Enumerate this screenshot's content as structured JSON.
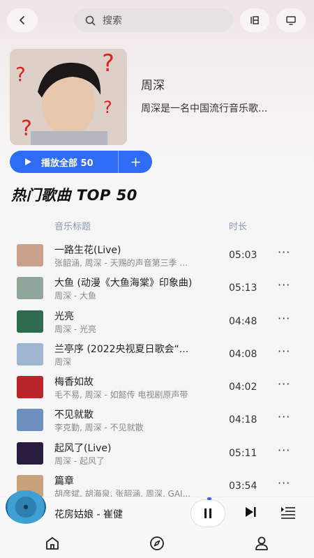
{
  "search": {
    "placeholder": "搜索"
  },
  "artist": {
    "name": "周深",
    "description": "周深是一名中国流行音乐歌..."
  },
  "play_all": {
    "label": "播放全部 50"
  },
  "section": {
    "title": "热门歌曲 TOP 50"
  },
  "columns": {
    "title": "音乐标题",
    "duration": "时长"
  },
  "songs": [
    {
      "title": "一路生花(Live)",
      "sub": "张韶涵, 周深 - 天赐的声音第三季 ...",
      "duration": "05:03",
      "cover": "#c9a08a"
    },
    {
      "title": "大鱼 (动漫《大鱼海棠》印象曲)",
      "sub": "周深 - 大鱼",
      "duration": "05:13",
      "cover": "#8fa79b"
    },
    {
      "title": "光亮",
      "sub": "周深 - 光亮",
      "duration": "04:48",
      "cover": "#2f6b4f"
    },
    {
      "title": "兰亭序 (2022央视夏日歌会“...",
      "sub": "周深",
      "duration": "04:08",
      "cover": "#9fb6d2"
    },
    {
      "title": "梅香如故",
      "sub": "毛不易, 周深 - 如懿传 电视剧原声带",
      "duration": "04:02",
      "cover": "#b9262a"
    },
    {
      "title": "不见就散",
      "sub": "李克勤, 周深 - 不见就散",
      "duration": "04:18",
      "cover": "#6d8fc0"
    },
    {
      "title": "起风了(Live)",
      "sub": "周深 - 起风了",
      "duration": "05:11",
      "cover": "#2a1c3e"
    },
    {
      "title": "篇章",
      "sub": "胡彦斌, 胡海泉, 张韶涵, 周深, GAI...",
      "duration": "03:54",
      "cover": "#c7a27a"
    }
  ],
  "more_label": "···",
  "player": {
    "now_playing": "花房姑娘 - 崔健"
  },
  "colors": {
    "accent": "#2e6cf6"
  }
}
